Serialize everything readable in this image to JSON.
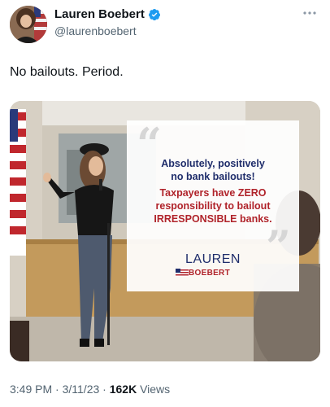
{
  "author": {
    "display_name": "Lauren Boebert",
    "handle": "@laurenboebert",
    "verified": true
  },
  "icons": {
    "verified": "verified-badge-icon",
    "more": "more-options-icon"
  },
  "tweet": {
    "text": "No bailouts. Period."
  },
  "media_quote": {
    "line1": "Absolutely, positively",
    "line2": "no bank bailouts!",
    "red_line1": "Taxpayers have ZERO",
    "red_line2": "responsibility to bailout",
    "red_line3": "IRRESPONSIBLE banks.",
    "logo_first": "LAUREN",
    "logo_last": "BOEBERT"
  },
  "meta": {
    "time": "3:49 PM",
    "separator": "·",
    "date": "3/11/23",
    "views_count": "162K",
    "views_label": "Views"
  },
  "colors": {
    "accent_blue": "#1d9bf0",
    "navy": "#1f2d6b",
    "red": "#b0232a",
    "muted": "#536471"
  }
}
